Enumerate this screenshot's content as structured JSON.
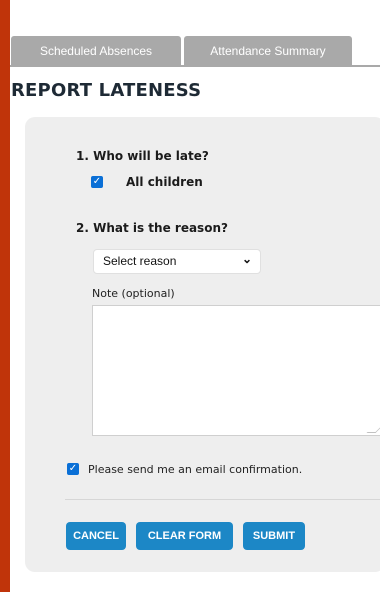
{
  "tabs": [
    "Scheduled Absences",
    "Attendance Summary"
  ],
  "page_title": "REPORT LATENESS",
  "question1": {
    "title": "1. Who will be late?",
    "option_label": "All children",
    "checked": true
  },
  "question2": {
    "title": "2. What is the reason?",
    "select_value": "Select reason"
  },
  "note": {
    "label": "Note (optional)",
    "value": ""
  },
  "email_confirmation": {
    "label": "Please send me an email confirmation.",
    "checked": true
  },
  "buttons": {
    "cancel": "CANCEL",
    "clear": "CLEAR FORM",
    "submit": "SUBMIT"
  },
  "colors": {
    "frame": "#c0340a",
    "tab": "#a9a9a9",
    "accent_button": "#1c87c6",
    "checkbox": "#0a6fd6"
  }
}
